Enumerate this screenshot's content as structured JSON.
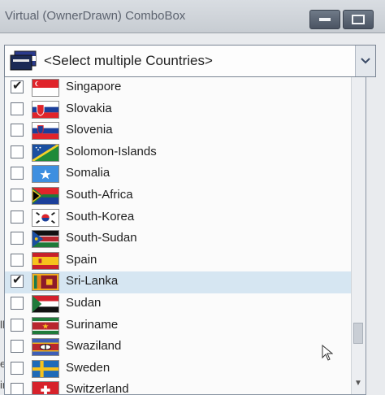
{
  "window": {
    "title": "Virtual (OwnerDrawn) ComboBox"
  },
  "combo": {
    "placeholder": "<Select multiple Countries>"
  },
  "countries": [
    {
      "name": "Singapore",
      "checked": true,
      "selected": false,
      "flag": "singapore"
    },
    {
      "name": "Slovakia",
      "checked": false,
      "selected": false,
      "flag": "slovakia"
    },
    {
      "name": "Slovenia",
      "checked": false,
      "selected": false,
      "flag": "slovenia"
    },
    {
      "name": "Solomon-Islands",
      "checked": false,
      "selected": false,
      "flag": "solomon"
    },
    {
      "name": "Somalia",
      "checked": false,
      "selected": false,
      "flag": "somalia"
    },
    {
      "name": "South-Africa",
      "checked": false,
      "selected": false,
      "flag": "southafrica"
    },
    {
      "name": "South-Korea",
      "checked": false,
      "selected": false,
      "flag": "southkorea"
    },
    {
      "name": "South-Sudan",
      "checked": false,
      "selected": false,
      "flag": "southsudan"
    },
    {
      "name": "Spain",
      "checked": false,
      "selected": false,
      "flag": "spain"
    },
    {
      "name": "Sri-Lanka",
      "checked": true,
      "selected": true,
      "flag": "srilanka"
    },
    {
      "name": "Sudan",
      "checked": false,
      "selected": false,
      "flag": "sudan"
    },
    {
      "name": "Suriname",
      "checked": false,
      "selected": false,
      "flag": "suriname"
    },
    {
      "name": "Swaziland",
      "checked": false,
      "selected": false,
      "flag": "swaziland"
    },
    {
      "name": "Sweden",
      "checked": false,
      "selected": false,
      "flag": "sweden"
    },
    {
      "name": "Switzerland",
      "checked": false,
      "selected": false,
      "flag": "switzerland"
    }
  ],
  "background_fragments": [
    "llo",
    "es",
    "ing"
  ],
  "colors": {
    "selection": "#d6e6f2",
    "border": "#8a95a3"
  }
}
